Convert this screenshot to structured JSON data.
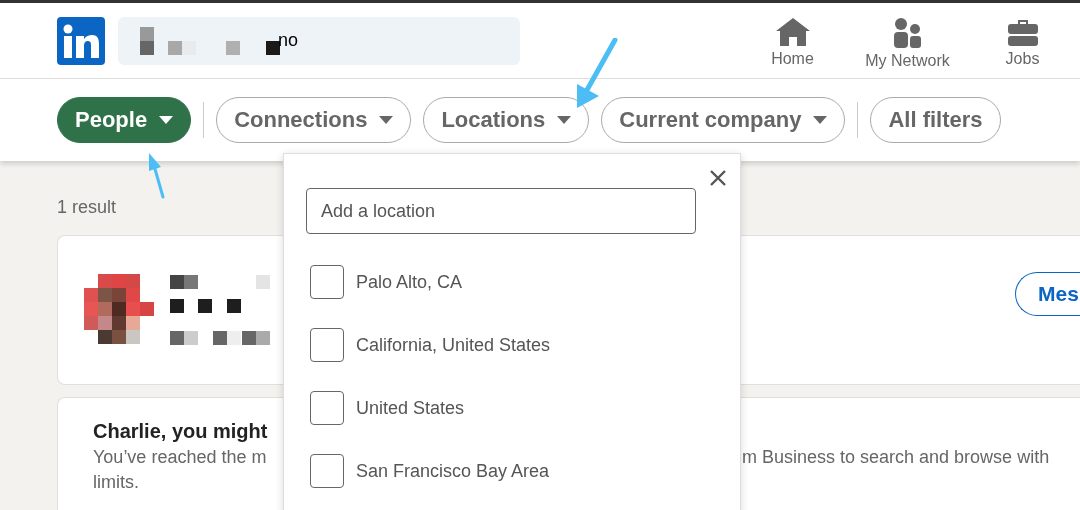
{
  "header": {
    "search_value": "no",
    "nav": [
      {
        "label": "Home"
      },
      {
        "label": "My Network"
      },
      {
        "label": "Jobs"
      }
    ]
  },
  "filter_groups": [
    [
      {
        "label": "People",
        "kind": "dropdown",
        "selected": true
      }
    ],
    [
      {
        "label": "Connections",
        "kind": "dropdown",
        "selected": false
      },
      {
        "label": "Locations",
        "kind": "dropdown",
        "selected": false
      },
      {
        "label": "Current company",
        "kind": "dropdown",
        "selected": false
      }
    ],
    [
      {
        "label": "All filters",
        "kind": "button",
        "selected": false
      }
    ]
  ],
  "result_count": "1 result",
  "result_card": {
    "action": "Mes"
  },
  "upsell_card": {
    "heading": "Charlie, you might",
    "text_left": "You’ve reached the m",
    "text_right": "m Business to search and browse with",
    "text_line_2": "limits."
  },
  "location_dropdown": {
    "placeholder": "Add a location",
    "options": [
      {
        "label": "Palo Alto, CA",
        "checked": false
      },
      {
        "label": "California, United States",
        "checked": false
      },
      {
        "label": "United States",
        "checked": false
      },
      {
        "label": "San Francisco Bay Area",
        "checked": false
      }
    ]
  }
}
